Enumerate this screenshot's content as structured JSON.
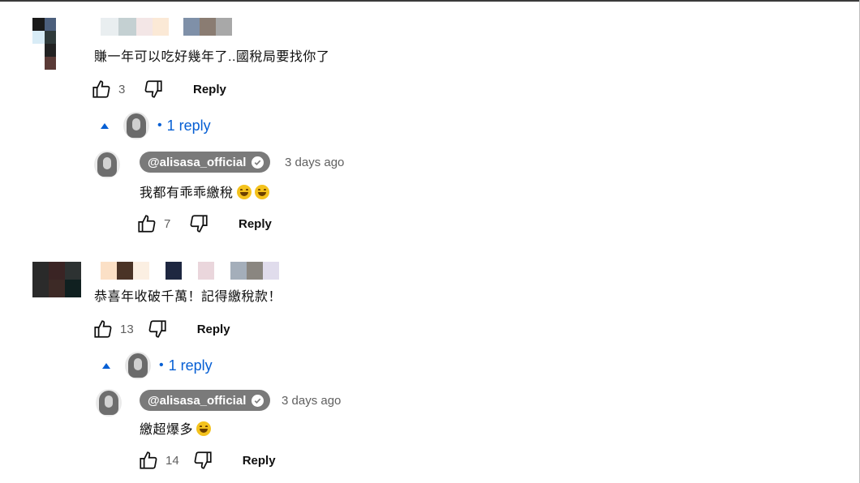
{
  "comments": [
    {
      "text": "賺一年可以吃好幾年了..國稅局要找你了",
      "likes": "3",
      "reply_label": "Reply",
      "replies_toggle": "1 reply",
      "reply": {
        "author": "@alisasa_official",
        "time": "3 days ago",
        "text": "我都有乖乖繳稅",
        "likes": "7",
        "reply_label": "Reply",
        "emoji_count": 2
      }
    },
    {
      "text": "恭喜年收破千萬！記得繳稅款！",
      "likes": "13",
      "reply_label": "Reply",
      "replies_toggle": "1 reply",
      "reply": {
        "author": "@alisasa_official",
        "time": "3 days ago",
        "text": "繳超爆多",
        "likes": "14",
        "reply_label": "Reply",
        "emoji_count": 1
      }
    }
  ],
  "icons": {
    "like": "thumbs-up-icon",
    "dislike": "thumbs-down-icon",
    "expand": "caret-up-icon",
    "verified": "verified-check-icon",
    "emoji": "grinning-face-icon"
  },
  "colors": {
    "link_blue": "#065fd4",
    "chip_gray": "#7a7a7a",
    "secondary_text": "#606060"
  }
}
